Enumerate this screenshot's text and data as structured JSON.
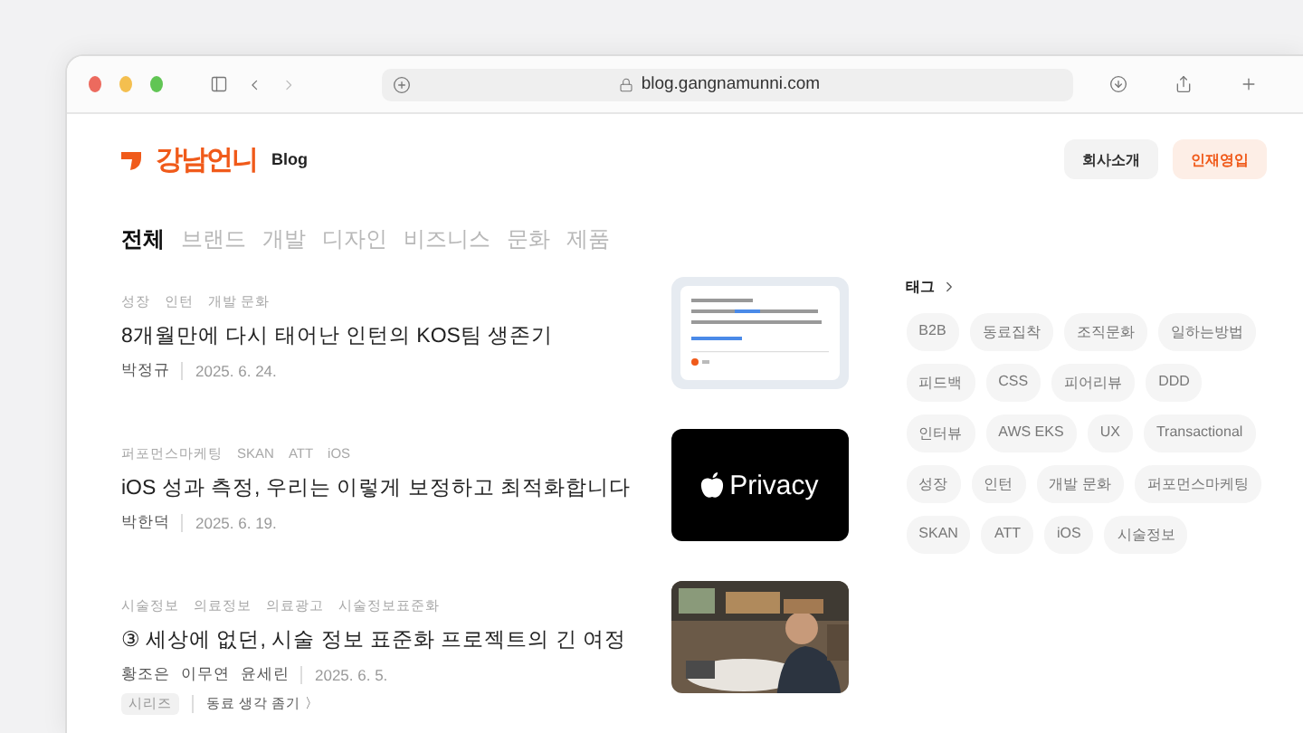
{
  "browser": {
    "url": "blog.gangnamunni.com"
  },
  "header": {
    "logo": "강남언니",
    "logo_sub": "Blog",
    "buttons": [
      {
        "label": "회사소개",
        "kind": "plain"
      },
      {
        "label": "인재영입",
        "kind": "accent"
      }
    ]
  },
  "categories": [
    {
      "label": "전체",
      "selected": true
    },
    {
      "label": "브랜드",
      "selected": false
    },
    {
      "label": "개발",
      "selected": false
    },
    {
      "label": "디자인",
      "selected": false
    },
    {
      "label": "비즈니스",
      "selected": false
    },
    {
      "label": "문화",
      "selected": false
    },
    {
      "label": "제품",
      "selected": false
    }
  ],
  "posts": [
    {
      "tags": [
        "성장",
        "인턴",
        "개발 문화"
      ],
      "title": "8개월만에 다시 태어난 인턴의 KOS팀 생존기",
      "authors": [
        "박정규"
      ],
      "date": "2025. 6. 24.",
      "thumb": {
        "kind": "note"
      }
    },
    {
      "tags": [
        "퍼포먼스마케팅",
        "SKAN",
        "ATT",
        "iOS"
      ],
      "title": "iOS 성과 측정, 우리는 이렇게 보정하고 최적화합니다",
      "authors": [
        "박한덕"
      ],
      "date": "2025. 6. 19.",
      "thumb": {
        "kind": "privacy",
        "text": "Privacy"
      }
    },
    {
      "tags": [
        "시술정보",
        "의료정보",
        "의료광고",
        "시술정보표준화"
      ],
      "title": "③ 세상에 없던, 시술 정보 표준화 프로젝트의 긴 여정",
      "authors": [
        "황조은",
        "이무연",
        "윤세린"
      ],
      "date": "2025. 6. 5.",
      "series": {
        "badge": "시리즈",
        "link": "동료 생각 좀기 〉"
      },
      "thumb": {
        "kind": "picture"
      }
    }
  ],
  "sidebar": {
    "title": "태그",
    "tags": [
      "B2B",
      "동료집착",
      "조직문화",
      "일하는방법",
      "피드백",
      "CSS",
      "피어리뷰",
      "DDD",
      "인터뷰",
      "AWS EKS",
      "UX",
      "Transactional",
      "성장",
      "인턴",
      "개발 문화",
      "퍼포먼스마케팅",
      "SKAN",
      "ATT",
      "iOS",
      "시술정보"
    ]
  }
}
